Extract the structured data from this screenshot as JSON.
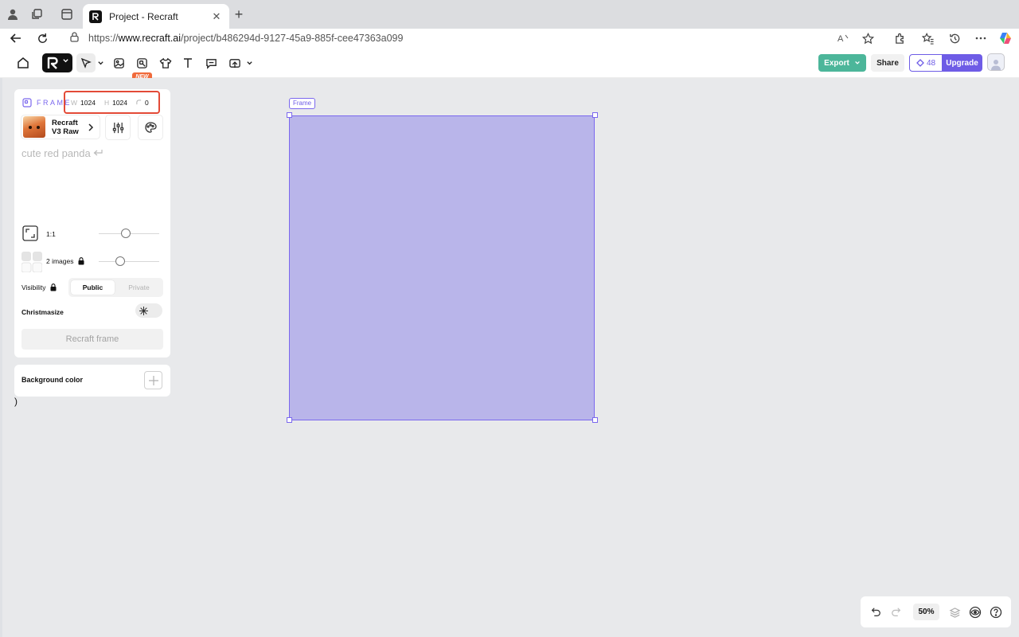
{
  "browser": {
    "tab_title": "Project - Recraft",
    "tab_close": "✕",
    "new_tab": "+",
    "url_prefix": "https://",
    "url_host": "www.recraft.ai",
    "url_path": "/project/b486294d-9127-45a9-885f-cee47363a099"
  },
  "toolbar": {
    "new_badge": "NEW",
    "export_label": "Export",
    "share_label": "Share",
    "credits_count": "48",
    "upgrade_label": "Upgrade"
  },
  "panel": {
    "frame_label": "FRAME",
    "width_label": "W",
    "width_value": "1024",
    "height_label": "H",
    "height_value": "1024",
    "radius_value": "0",
    "model_name_line1": "Recraft",
    "model_name_line2": "V3 Raw",
    "prompt": "cute red panda",
    "ratio_label": "1:1",
    "images_label": "2 images",
    "visibility_label": "Visibility",
    "visibility_public": "Public",
    "visibility_private": "Private",
    "christmasize_label": "Christmasize",
    "recraft_button": "Recraft frame",
    "bg_color_label": "Background color",
    "stray_text": ")"
  },
  "canvas": {
    "frame_tag": "Frame",
    "zoom": "50%"
  },
  "colors": {
    "accent": "#6e5ce6",
    "export_green": "#4cb69a",
    "frame_fill": "#b9b5ea",
    "highlight_red": "#e34a37"
  }
}
